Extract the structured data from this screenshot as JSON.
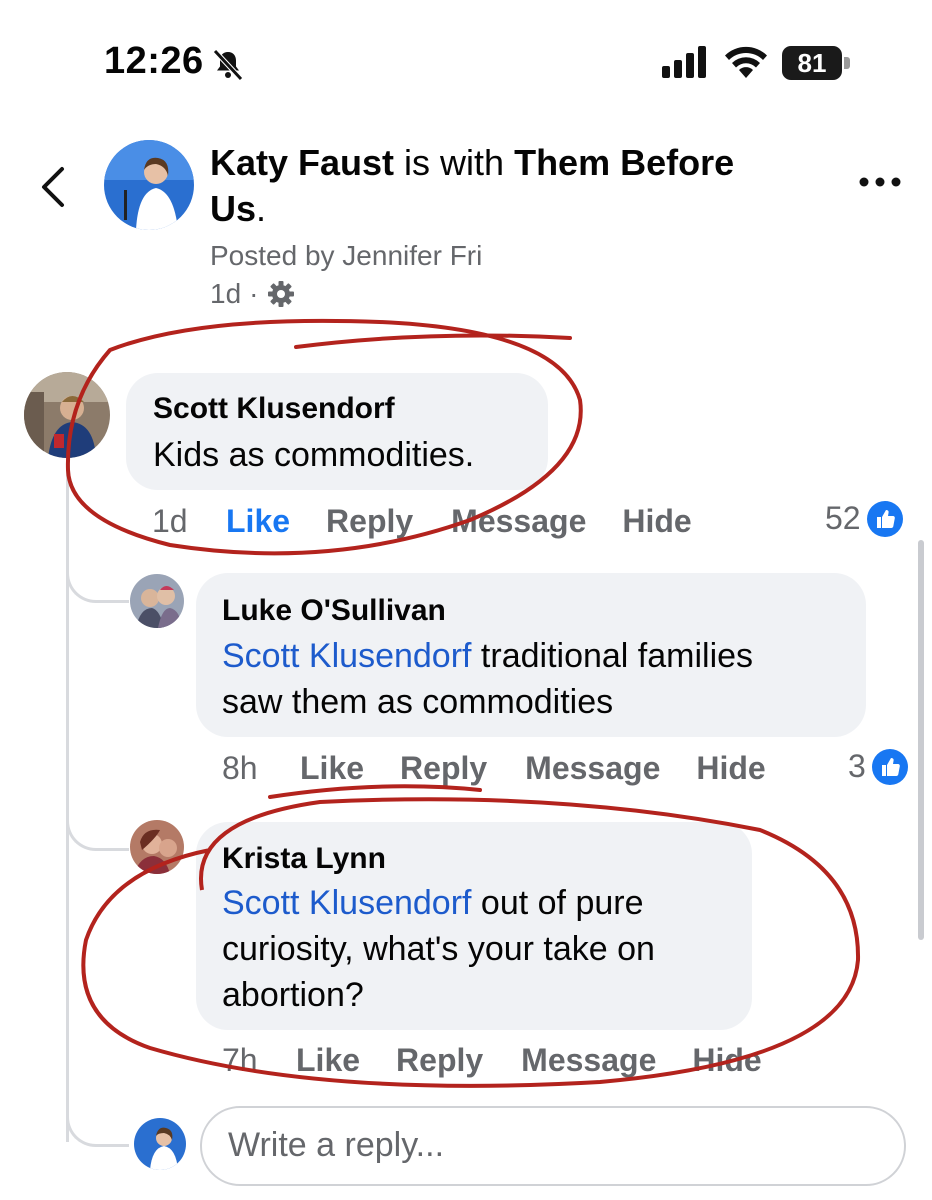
{
  "status_bar": {
    "time": "12:26",
    "battery": "81"
  },
  "post": {
    "author": "Katy Faust",
    "connector": " is with ",
    "group": "Them Before",
    "group_line2": "Us",
    "period": ".",
    "posted_by": "Posted by Jennifer Fri",
    "age": "1d",
    "separator": "·"
  },
  "comments": [
    {
      "name": "Scott Klusendorf",
      "text": "Kids as commodities.",
      "age": "1d",
      "actions": {
        "like": "Like",
        "reply": "Reply",
        "message": "Message",
        "hide": "Hide"
      },
      "reaction_count": "52"
    },
    {
      "name": "Luke O'Sullivan",
      "mention": "Scott Klusendorf",
      "text_line1": " traditional families",
      "text_line2": "saw them as commodities",
      "age": "8h",
      "actions": {
        "like": "Like",
        "reply": "Reply",
        "message": "Message",
        "hide": "Hide"
      },
      "reaction_count": "3"
    },
    {
      "name": "Krista Lynn",
      "mention": "Scott Klusendorf",
      "text_line1": " out of pure",
      "text_line2": "curiosity, what's your take on",
      "text_line3": "abortion?",
      "age": "7h",
      "actions": {
        "like": "Like",
        "reply": "Reply",
        "message": "Message",
        "hide": "Hide"
      }
    }
  ],
  "reply_input": {
    "placeholder": "Write a reply..."
  },
  "colors": {
    "link_blue": "#1d5bcc",
    "fb_blue": "#1877f2",
    "annotation_red": "#b3231d",
    "bubble_gray": "#f0f2f5"
  }
}
